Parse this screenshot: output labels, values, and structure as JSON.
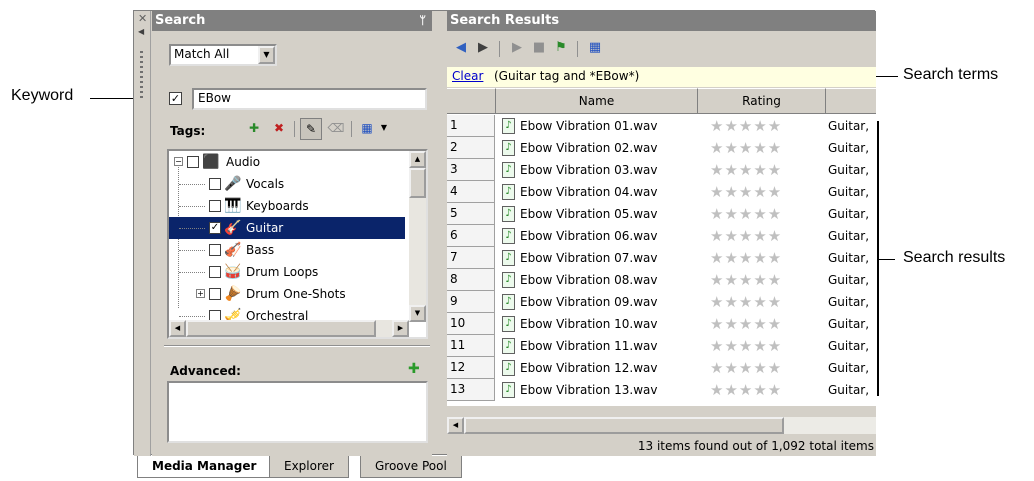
{
  "callouts": {
    "keyword": "Keyword",
    "search_terms": "Search terms",
    "search_results": "Search results"
  },
  "search_panel": {
    "title": "Search",
    "match_mode": "Match All",
    "keyword_checked": true,
    "keyword_value": "EBow",
    "tags_label": "Tags:",
    "advanced_label": "Advanced:",
    "tree": [
      {
        "label": "Audio",
        "icon": "audio-tag-icon",
        "checked": false,
        "expandable": true,
        "expanded": true,
        "level": 0
      },
      {
        "label": "Vocals",
        "icon": "microphone-icon",
        "checked": false,
        "level": 1
      },
      {
        "label": "Keyboards",
        "icon": "keyboard-icon",
        "checked": false,
        "level": 1
      },
      {
        "label": "Guitar",
        "icon": "guitar-icon",
        "checked": true,
        "selected": true,
        "level": 1
      },
      {
        "label": "Bass",
        "icon": "bass-icon",
        "checked": false,
        "level": 1
      },
      {
        "label": "Drum Loops",
        "icon": "drum-icon",
        "checked": false,
        "level": 1
      },
      {
        "label": "Drum One-Shots",
        "icon": "drum-oneshot-icon",
        "checked": false,
        "expandable": true,
        "level": 1
      },
      {
        "label": "Orchestral",
        "icon": "orchestral-icon",
        "checked": false,
        "level": 1
      }
    ]
  },
  "results_panel": {
    "title": "Search Results",
    "clear_label": "Clear",
    "search_terms": "(Guitar tag and *EBow*)",
    "columns": [
      "Name",
      "Rating"
    ],
    "rows": [
      {
        "num": "1",
        "name": "Ebow Vibration 01.wav",
        "tags": "Guitar,"
      },
      {
        "num": "2",
        "name": "Ebow Vibration 02.wav",
        "tags": "Guitar,"
      },
      {
        "num": "3",
        "name": "Ebow Vibration 03.wav",
        "tags": "Guitar,"
      },
      {
        "num": "4",
        "name": "Ebow Vibration 04.wav",
        "tags": "Guitar,"
      },
      {
        "num": "5",
        "name": "Ebow Vibration 05.wav",
        "tags": "Guitar,"
      },
      {
        "num": "6",
        "name": "Ebow Vibration 06.wav",
        "tags": "Guitar,"
      },
      {
        "num": "7",
        "name": "Ebow Vibration 07.wav",
        "tags": "Guitar,"
      },
      {
        "num": "8",
        "name": "Ebow Vibration 08.wav",
        "tags": "Guitar,"
      },
      {
        "num": "9",
        "name": "Ebow Vibration 09.wav",
        "tags": "Guitar,"
      },
      {
        "num": "10",
        "name": "Ebow Vibration 10.wav",
        "tags": "Guitar,"
      },
      {
        "num": "11",
        "name": "Ebow Vibration 11.wav",
        "tags": "Guitar,"
      },
      {
        "num": "12",
        "name": "Ebow Vibration 12.wav",
        "tags": "Guitar,"
      },
      {
        "num": "13",
        "name": "Ebow Vibration 13.wav",
        "tags": "Guitar,"
      }
    ],
    "rating_stars": "★★★★★",
    "status": "13 items found out of 1,092 total items"
  },
  "tabs": [
    {
      "label": "Media Manager",
      "active": true
    },
    {
      "label": "Explorer",
      "active": false
    },
    {
      "label": "Groove Pool",
      "active": false
    }
  ]
}
